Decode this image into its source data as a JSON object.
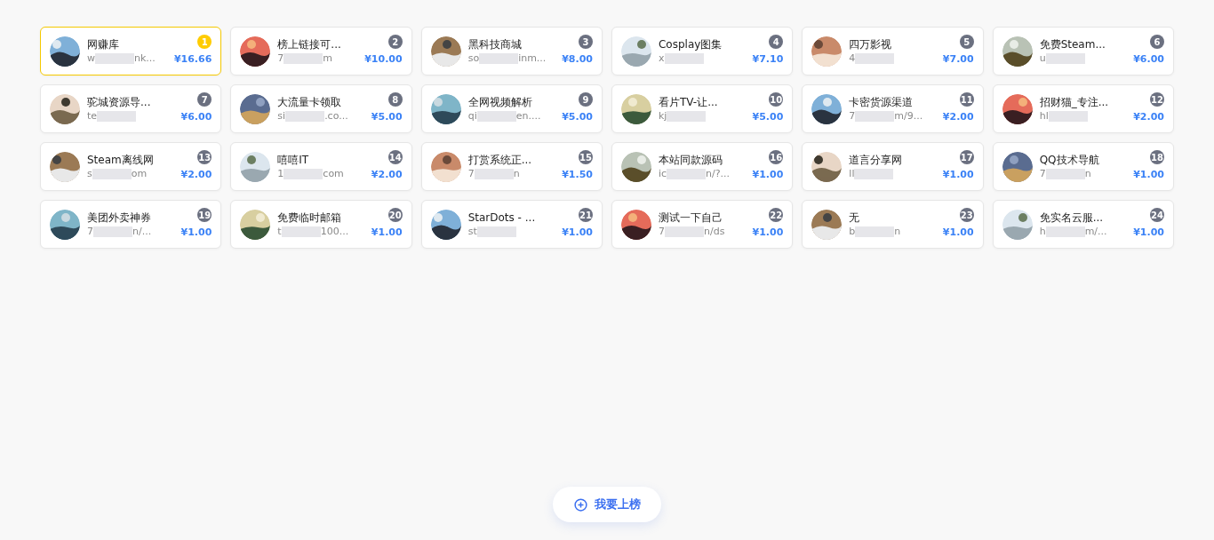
{
  "sites": [
    {
      "rank": "1",
      "top": true,
      "title": "网赚库",
      "url_start": "w",
      "url_end": "nk...",
      "price": "¥16.66"
    },
    {
      "rank": "2",
      "top": false,
      "title": "榜上链接可...",
      "url_start": "7",
      "url_end": "m",
      "price": "¥10.00"
    },
    {
      "rank": "3",
      "top": false,
      "title": "黑科技商城",
      "url_start": "so",
      "url_end": "inm...",
      "price": "¥8.00"
    },
    {
      "rank": "4",
      "top": false,
      "title": "Cosplay图集",
      "url_start": "x",
      "price": "¥7.10"
    },
    {
      "rank": "5",
      "top": false,
      "title": "四万影视",
      "url_start": "4",
      "price": "¥7.00"
    },
    {
      "rank": "6",
      "top": false,
      "title": "免费Steam...",
      "url_start": "u",
      "price": "¥6.00"
    },
    {
      "rank": "7",
      "top": false,
      "title": "驼城资源导...",
      "url_start": "te",
      "price": "¥6.00"
    },
    {
      "rank": "8",
      "top": false,
      "title": "大流量卡领取",
      "url_start": "si",
      "url_end": ".co...",
      "price": "¥5.00"
    },
    {
      "rank": "9",
      "top": false,
      "title": "全网视频解析",
      "url_start": "qi",
      "url_end": "en....",
      "price": "¥5.00"
    },
    {
      "rank": "10",
      "top": false,
      "title": "看片TV-让...",
      "url_start": "kj",
      "price": "¥5.00"
    },
    {
      "rank": "11",
      "top": false,
      "title": "卡密货源渠道",
      "url_start": "7",
      "url_end": "m/9...",
      "price": "¥2.00"
    },
    {
      "rank": "12",
      "top": false,
      "title": "招财猫_专注...",
      "url_start": "hl",
      "price": "¥2.00"
    },
    {
      "rank": "13",
      "top": false,
      "title": "Steam离线网",
      "url_start": "s",
      "url_end": "om",
      "price": "¥2.00"
    },
    {
      "rank": "14",
      "top": false,
      "title": "嘻嘻IT",
      "url_start": "1",
      "url_end": "com",
      "price": "¥2.00"
    },
    {
      "rank": "15",
      "top": false,
      "title": "打赏系统正...",
      "url_start": "7",
      "url_end": "n",
      "price": "¥1.50"
    },
    {
      "rank": "16",
      "top": false,
      "title": "本站同款源码",
      "url_start": "ic",
      "url_end": "n/?...",
      "price": "¥1.00"
    },
    {
      "rank": "17",
      "top": false,
      "title": "道言分享网",
      "url_start": "ll",
      "price": "¥1.00"
    },
    {
      "rank": "18",
      "top": false,
      "title": "QQ技术导航",
      "url_start": "7",
      "url_end": "n",
      "price": "¥1.00"
    },
    {
      "rank": "19",
      "top": false,
      "title": "美团外卖神券",
      "url_start": "7",
      "url_end": "n/...",
      "price": "¥1.00"
    },
    {
      "rank": "20",
      "top": false,
      "title": "免费临时邮箱",
      "url_start": "t",
      "url_end": "100...",
      "price": "¥1.00"
    },
    {
      "rank": "21",
      "top": false,
      "title": "StarDots - ...",
      "url_start": "st",
      "price": "¥1.00"
    },
    {
      "rank": "22",
      "top": false,
      "title": "测试一下自己",
      "url_start": "7",
      "url_end": "n/ds",
      "price": "¥1.00"
    },
    {
      "rank": "23",
      "top": false,
      "title": "无",
      "url_start": "b",
      "url_end": "n",
      "price": "¥1.00"
    },
    {
      "rank": "24",
      "top": false,
      "title": "免实名云服...",
      "url_start": "h",
      "url_end": "m/...",
      "price": "¥1.00"
    }
  ],
  "join_button": {
    "label": "我要上榜"
  }
}
